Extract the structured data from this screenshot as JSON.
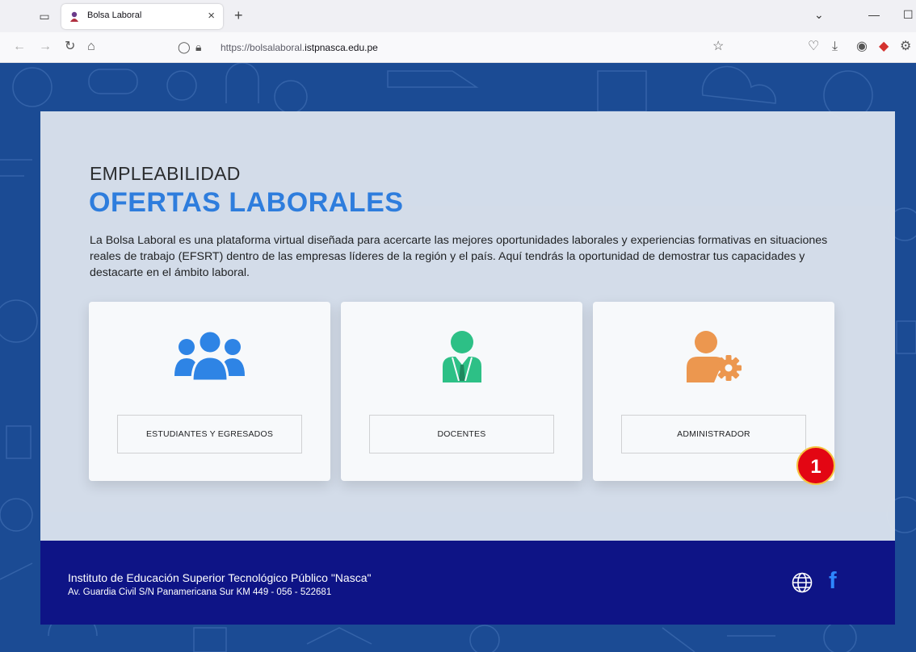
{
  "browser": {
    "tab_title": "Bolsa Laboral",
    "tab_close": "×",
    "new_tab": "+",
    "url_prefix": "https://bolsalaboral.",
    "url_domain": "istpnasca.edu.pe"
  },
  "hero": {
    "kicker": "EMPLEABILIDAD",
    "headline": "OFERTAS LABORALES",
    "intro": "La Bolsa Laboral es una plataforma virtual diseñada para acercarte las mejores oportunidades laborales y experiencias formativas en situaciones reales de trabajo (EFSRT) dentro de las empresas líderes de la región y el país. Aquí tendrás la oportunidad de demostrar tus capacidades y destacarte en el ámbito laboral."
  },
  "cards": [
    {
      "label": "ESTUDIANTES Y EGRESADOS",
      "icon": "users-group-icon",
      "color": "#2f86e8"
    },
    {
      "label": "DOCENTES",
      "icon": "teacher-icon",
      "color": "#2ec486"
    },
    {
      "label": "ADMINISTRADOR",
      "icon": "admin-gear-icon",
      "color": "#f39a4d"
    }
  ],
  "badge": {
    "number": "1",
    "color": "#e30613"
  },
  "footer": {
    "name": "Instituto de Educación Superior Tecnológico Público \"Nasca\"",
    "address": "Av. Guardia Civil S/N Panamericana Sur KM 449 - 056 - 522681",
    "social": [
      "globe-icon",
      "facebook-icon"
    ],
    "facebook_glyph": "f"
  },
  "colors": {
    "page_bg": "#1b4b94",
    "accent": "#2f7fe0",
    "footer_bg": "#0e1486"
  }
}
